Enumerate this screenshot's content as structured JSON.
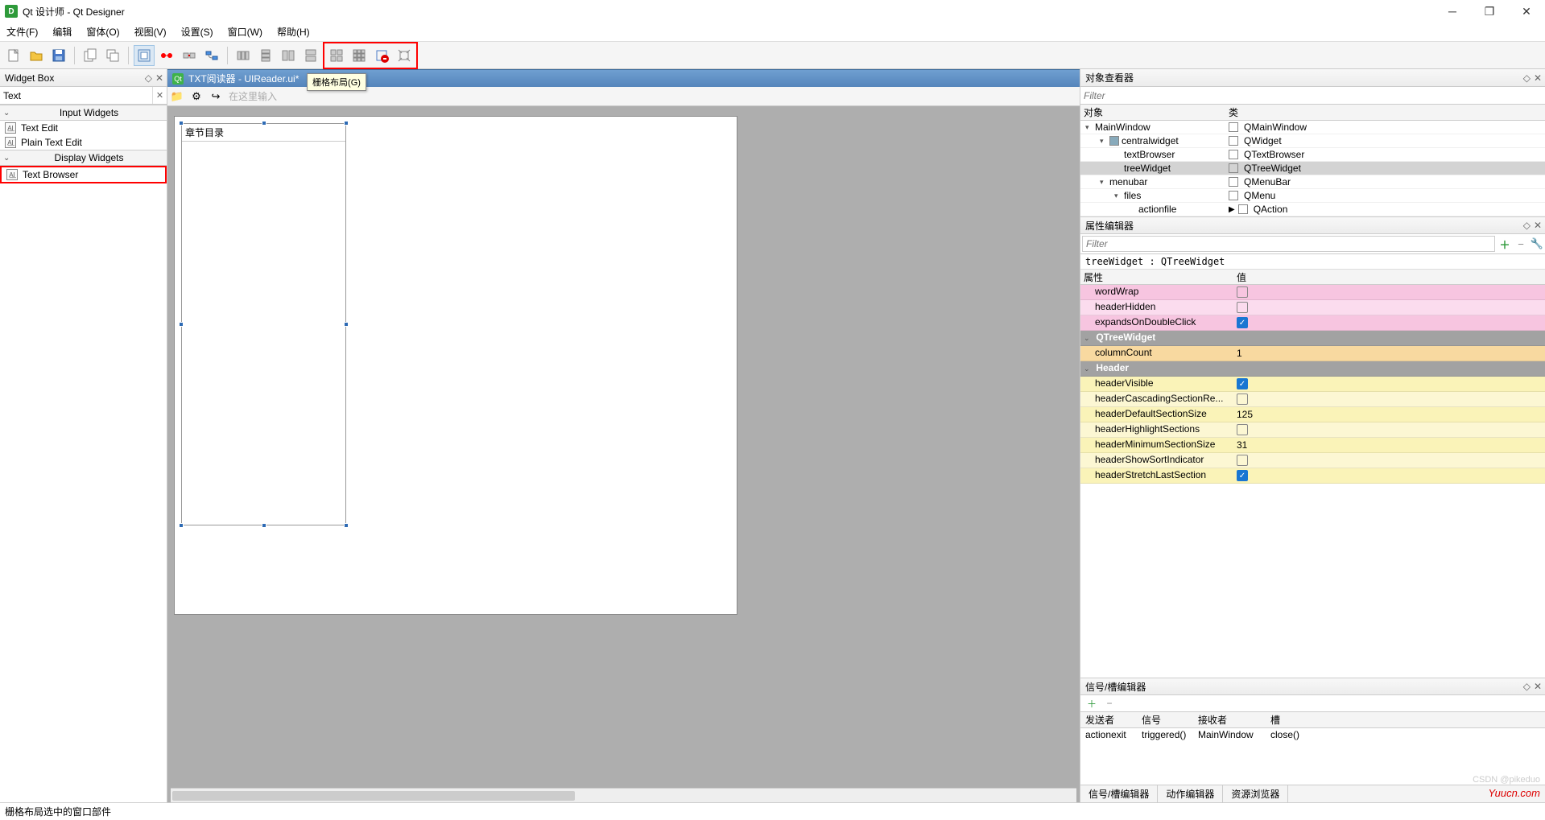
{
  "title": "Qt 设计师 - Qt Designer",
  "menu": [
    "文件(F)",
    "编辑",
    "窗体(O)",
    "视图(V)",
    "设置(S)",
    "窗口(W)",
    "帮助(H)"
  ],
  "tooltip": "栅格布局(G)",
  "widgetBox": {
    "title": "Widget Box",
    "filter": "Text",
    "groups": [
      {
        "name": "Input Widgets",
        "items": [
          {
            "label": "Text Edit",
            "hl": false
          },
          {
            "label": "Plain Text Edit",
            "hl": false
          }
        ]
      },
      {
        "name": "Display Widgets",
        "items": [
          {
            "label": "Text Browser",
            "hl": true
          }
        ]
      }
    ]
  },
  "form": {
    "tab": "TXT阅读器 - UIReader.ui*",
    "menuHint": "在这里输入",
    "treeHeader": "章节目录"
  },
  "objectInspector": {
    "title": "对象查看器",
    "filterPlaceholder": "Filter",
    "cols": [
      "对象",
      "类"
    ],
    "rows": [
      {
        "indent": 0,
        "exp": "▾",
        "name": "MainWindow",
        "cls": "QMainWindow",
        "sel": false
      },
      {
        "indent": 1,
        "exp": "▾",
        "name": "centralwidget",
        "cls": "QWidget",
        "sel": false,
        "gridIcon": true
      },
      {
        "indent": 2,
        "exp": "",
        "name": "textBrowser",
        "cls": "QTextBrowser",
        "sel": false
      },
      {
        "indent": 2,
        "exp": "",
        "name": "treeWidget",
        "cls": "QTreeWidget",
        "sel": true
      },
      {
        "indent": 1,
        "exp": "▾",
        "name": "menubar",
        "cls": "QMenuBar",
        "sel": false
      },
      {
        "indent": 2,
        "exp": "▾",
        "name": "files",
        "cls": "QMenu",
        "sel": false
      },
      {
        "indent": 3,
        "exp": "",
        "name": "actionfile",
        "cls": "QAction",
        "sel": false,
        "actIcon": true
      }
    ]
  },
  "propertyEditor": {
    "title": "属性编辑器",
    "filterPlaceholder": "Filter",
    "objLine": "treeWidget : QTreeWidget",
    "cols": [
      "属性",
      "值"
    ],
    "rows": [
      {
        "type": "pink",
        "name": "wordWrap",
        "val": "check",
        "checked": false
      },
      {
        "type": "pink2",
        "name": "headerHidden",
        "val": "check",
        "checked": false
      },
      {
        "type": "pink",
        "name": "expandsOnDoubleClick",
        "val": "check",
        "checked": true
      },
      {
        "type": "grey",
        "name": "QTreeWidget",
        "isHeader": true
      },
      {
        "type": "orange",
        "name": "columnCount",
        "val": "1"
      },
      {
        "type": "grey",
        "name": "Header",
        "isHeader": true
      },
      {
        "type": "yellow",
        "name": "headerVisible",
        "val": "check",
        "checked": true
      },
      {
        "type": "yellow2",
        "name": "headerCascadingSectionRe...",
        "val": "check",
        "checked": false
      },
      {
        "type": "yellow",
        "name": "headerDefaultSectionSize",
        "val": "125"
      },
      {
        "type": "yellow2",
        "name": "headerHighlightSections",
        "val": "check",
        "checked": false
      },
      {
        "type": "yellow",
        "name": "headerMinimumSectionSize",
        "val": "31"
      },
      {
        "type": "yellow2",
        "name": "headerShowSortIndicator",
        "val": "check",
        "checked": false
      },
      {
        "type": "yellow",
        "name": "headerStretchLastSection",
        "val": "check",
        "checked": true
      }
    ]
  },
  "signalEditor": {
    "title": "信号/槽编辑器",
    "cols": [
      "发送者",
      "信号",
      "接收者",
      "槽"
    ],
    "row": [
      "actionexit",
      "triggered()",
      "MainWindow",
      "close()"
    ]
  },
  "bottomTabs": [
    "信号/槽编辑器",
    "动作编辑器",
    "资源浏览器"
  ],
  "status": "栅格布局选中的窗口部件",
  "watermark": "Yuucn.com",
  "watermark2": "CSDN @pikeduo"
}
